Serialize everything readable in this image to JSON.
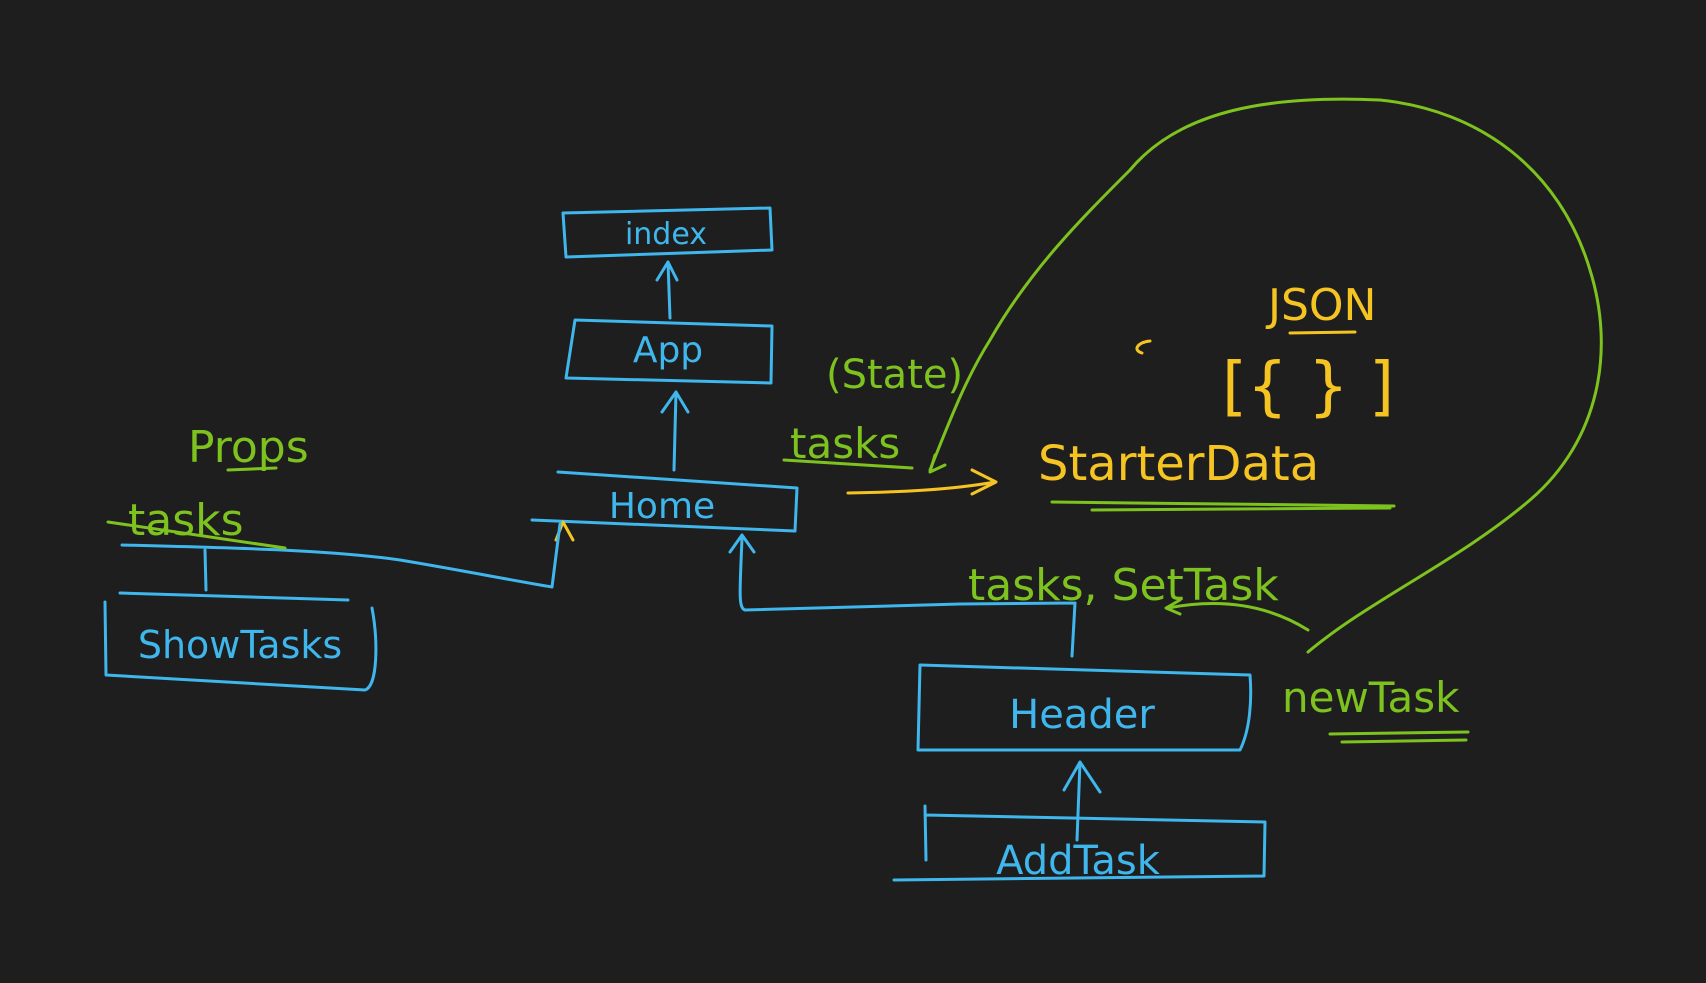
{
  "colors": {
    "background": "#1e1e1e",
    "component": "#3fb6ec",
    "annotation": "#7dc21e",
    "data": "#f5c423"
  },
  "nodes": {
    "index": "index",
    "app": "App",
    "home": "Home",
    "show_tasks": "ShowTasks",
    "header": "Header",
    "add_task": "AddTask"
  },
  "labels": {
    "props": "Props",
    "tasks_props": "tasks",
    "state": "(State)",
    "tasks_state": "tasks",
    "json": "JSON",
    "json_bracket": "[{ } ]",
    "starter_data": "StarterData",
    "tasks_set_task": "tasks, SetTask",
    "new_task": "newTask"
  }
}
